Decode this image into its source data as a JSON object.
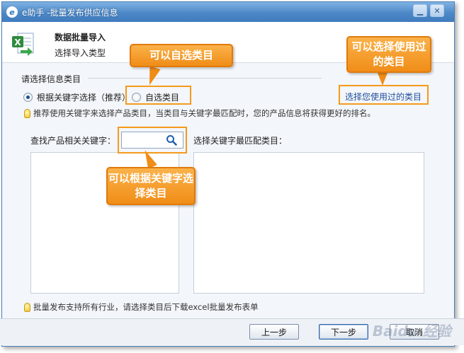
{
  "window": {
    "title": "e助手 -批量发布供应信息",
    "icon_letter": "e"
  },
  "titlebar": {
    "min_glyph": "▁",
    "close_glyph": "✕"
  },
  "header": {
    "title": "数据批量导入",
    "subtitle": "选择导入类型",
    "icon": "excel-import-icon"
  },
  "section": {
    "title": "请选择信息类目"
  },
  "radios": [
    {
      "label": "根据关键字选择（推荐）",
      "checked": true
    },
    {
      "label": "自选类目",
      "checked": false
    }
  ],
  "used_link": "选择您使用过的类目",
  "tips": {
    "recommend": "推荐使用关键字来选择产品类目，当类目与关键字最匹配时，您的产品信息将获得更好的排名。",
    "bottom": "批量发布支持所有行业，请选择类目后下载excel批量发布表单"
  },
  "search": {
    "label": "查找产品相关关键字：",
    "value": "",
    "placeholder": ""
  },
  "match_label": "选择关键字最匹配类目：",
  "buttons": {
    "prev": "上一步",
    "next": "下一步",
    "cancel": "取消"
  },
  "callouts": {
    "custom": "可以自选类目",
    "used": "可以选择使用过的类目",
    "keyword": "可以根据关键字选择类目"
  },
  "watermark": "Baidu 经验",
  "colors": {
    "accent": "#f08d18",
    "titlebar": "#4d88c7",
    "link": "#1f4e9a"
  }
}
